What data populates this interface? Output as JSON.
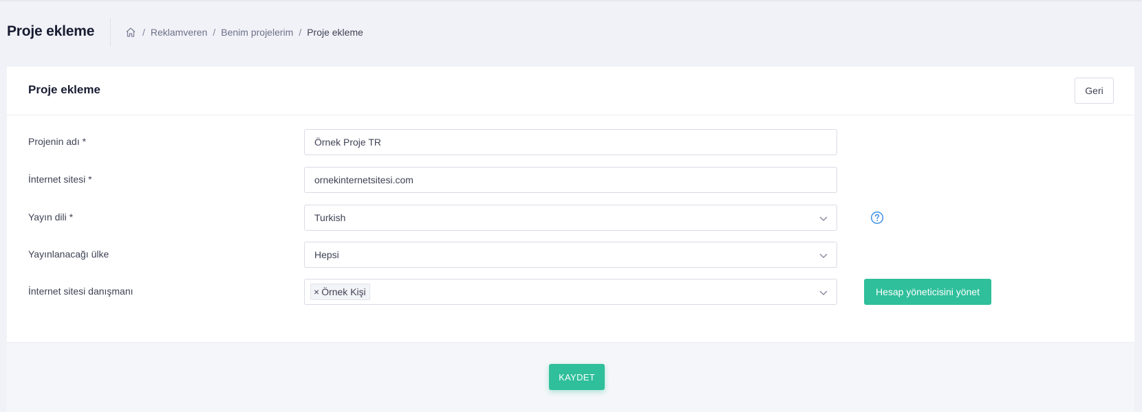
{
  "subheader": {
    "title": "Proje ekleme",
    "breadcrumb": [
      "Reklamveren",
      "Benim projelerim",
      "Proje ekleme"
    ],
    "separator": "/"
  },
  "card": {
    "title": "Proje ekleme",
    "back_label": "Geri"
  },
  "form": {
    "project_name": {
      "label": "Projenin adı *",
      "value": "Örnek Proje TR"
    },
    "website": {
      "label": "İnternet sitesi *",
      "value": "ornekinternetsitesi.com"
    },
    "language": {
      "label": "Yayın dili *",
      "value": "Turkish"
    },
    "country": {
      "label": "Yayınlanacağı ülke",
      "value": "Hepsi"
    },
    "consultant": {
      "label": "İnternet sitesi danışmanı",
      "tag": "Örnek Kişi",
      "tag_remove": "×",
      "manage_label": "Hesap yöneticisini yönet"
    }
  },
  "footer": {
    "save_label": "KAYDET"
  },
  "colors": {
    "accent": "#2fbf9b",
    "help": "#3b8fe6",
    "background": "#f1f2f7"
  },
  "icons": [
    "home-icon",
    "chevron-down-icon",
    "question-circle-icon",
    "close-icon"
  ]
}
